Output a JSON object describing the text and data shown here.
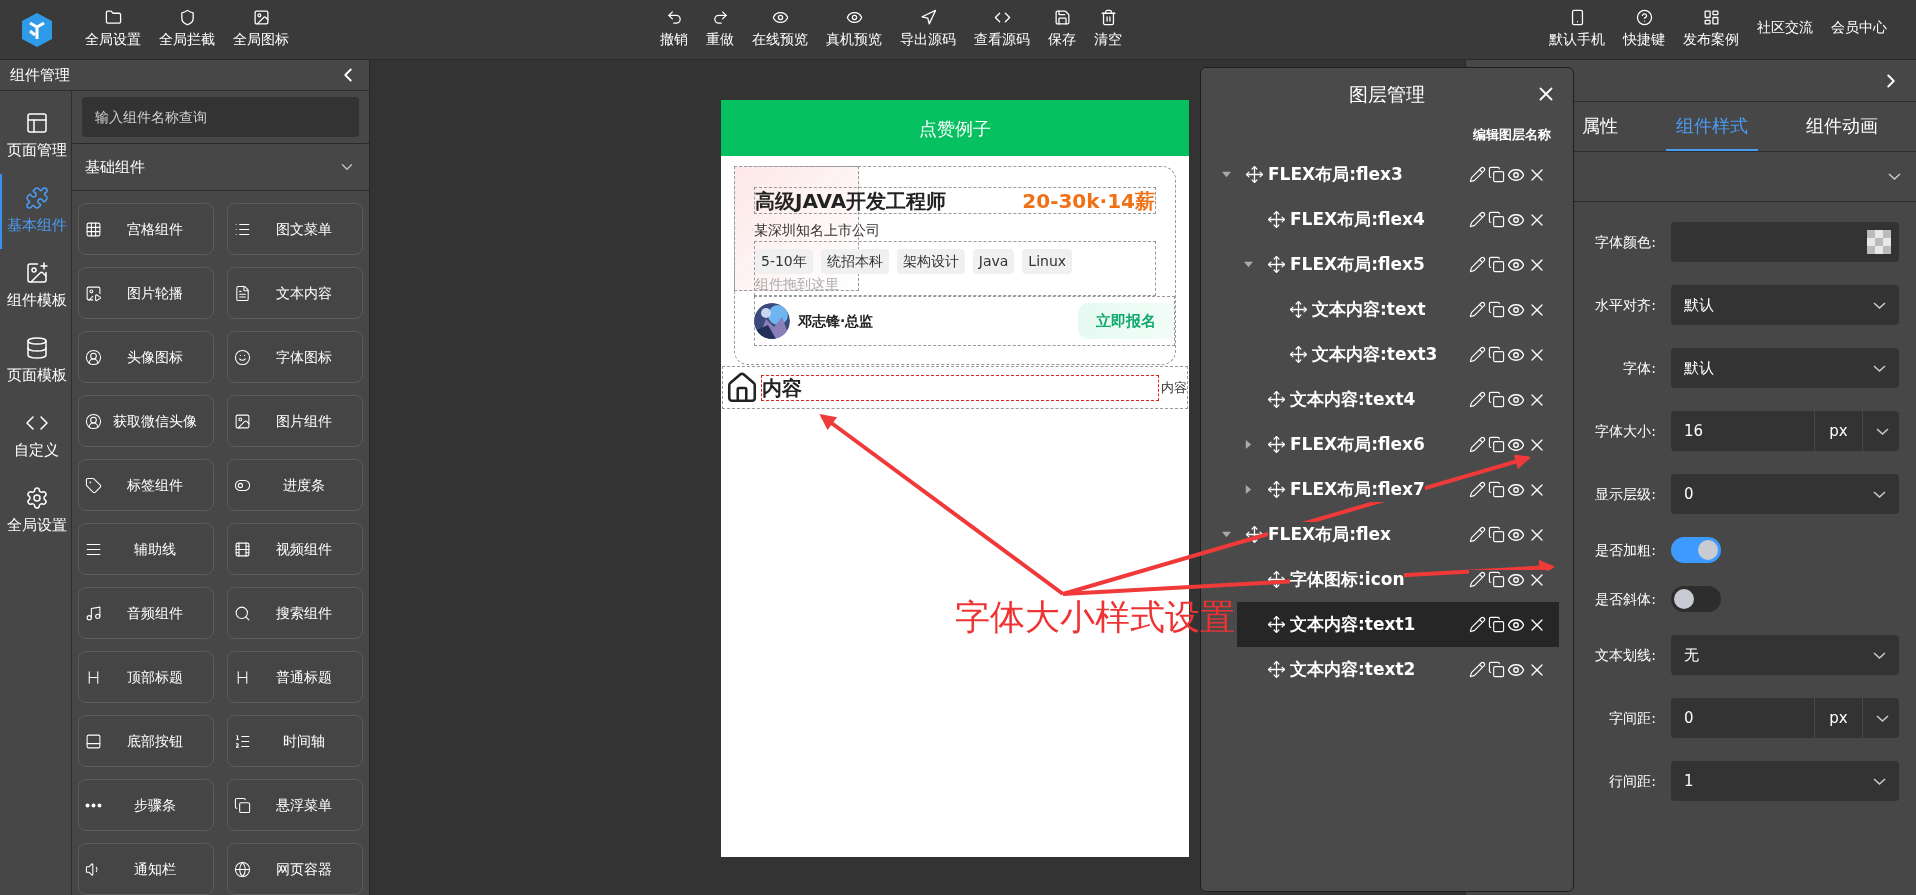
{
  "toolbar": {
    "left": [
      {
        "label": "全局设置"
      },
      {
        "label": "全局拦截"
      },
      {
        "label": "全局图标"
      }
    ],
    "center": [
      {
        "label": "撤销"
      },
      {
        "label": "重做"
      },
      {
        "label": "在线预览"
      },
      {
        "label": "真机预览"
      },
      {
        "label": "导出源码"
      },
      {
        "label": "查看源码"
      },
      {
        "label": "保存"
      },
      {
        "label": "清空"
      }
    ],
    "right": [
      {
        "label": "默认手机",
        "kind": "icon"
      },
      {
        "label": "快捷键",
        "kind": "icon"
      },
      {
        "label": "发布案例",
        "kind": "icon"
      },
      {
        "label": "社区交流",
        "kind": "text"
      },
      {
        "label": "会员中心",
        "kind": "text"
      }
    ]
  },
  "left_panel": {
    "title": "组件管理",
    "rail": [
      {
        "label": "页面管理",
        "selected": false
      },
      {
        "label": "基本组件",
        "selected": true
      },
      {
        "label": "组件模板",
        "selected": false
      },
      {
        "label": "页面模板",
        "selected": false
      },
      {
        "label": "自定义",
        "selected": false
      },
      {
        "label": "全局设置",
        "selected": false
      }
    ],
    "search": {
      "placeholder": "输入组件名称查询"
    },
    "category": {
      "label": "基础组件",
      "expanded": true
    },
    "components": [
      {
        "label": "宫格组件"
      },
      {
        "label": "图文菜单"
      },
      {
        "label": "图片轮播"
      },
      {
        "label": "文本内容"
      },
      {
        "label": "头像图标"
      },
      {
        "label": "字体图标"
      },
      {
        "label": "获取微信头像"
      },
      {
        "label": "图片组件"
      },
      {
        "label": "标签组件"
      },
      {
        "label": "进度条"
      },
      {
        "label": "辅助线"
      },
      {
        "label": "视频组件"
      },
      {
        "label": "音频组件"
      },
      {
        "label": "搜索组件"
      },
      {
        "label": "顶部标题"
      },
      {
        "label": "普通标题"
      },
      {
        "label": "底部按钮"
      },
      {
        "label": "时间轴"
      },
      {
        "label": "步骤条"
      },
      {
        "label": "悬浮菜单"
      },
      {
        "label": "通知栏"
      },
      {
        "label": "网页容器"
      }
    ]
  },
  "phone": {
    "title": "点赞例子",
    "card": {
      "job": "高级JAVA开发工程师",
      "salary": "20-30k·14薪",
      "company": "某深圳知名上市公司",
      "tags": [
        "5-10年",
        "统招本科",
        "架构设计",
        "Java",
        "Linux"
      ],
      "drop_hint": "组件拖到这里",
      "person": "邓志锋·总监",
      "button": "立即报名"
    },
    "row": {
      "text": "内容",
      "side_text": "内容"
    }
  },
  "layers": {
    "title": "图层管理",
    "edit_label": "编辑图层名称",
    "items": [
      {
        "label": "FLEX布局:flex3",
        "kind": "group",
        "expanded": true,
        "selected": false,
        "children": [
          {
            "label": "FLEX布局:flex4",
            "kind": "leaf",
            "selected": false
          },
          {
            "label": "FLEX布局:flex5",
            "kind": "group",
            "expanded": true,
            "selected": false,
            "children": [
              {
                "label": "文本内容:text",
                "kind": "leaf",
                "selected": false
              },
              {
                "label": "文本内容:text3",
                "kind": "leaf",
                "selected": false
              }
            ]
          },
          {
            "label": "文本内容:text4",
            "kind": "leaf",
            "selected": false
          },
          {
            "label": "FLEX布局:flex6",
            "kind": "group",
            "expanded": false,
            "selected": false
          },
          {
            "label": "FLEX布局:flex7",
            "kind": "group",
            "expanded": false,
            "selected": false
          }
        ]
      },
      {
        "label": "FLEX布局:flex",
        "kind": "group",
        "expanded": true,
        "selected": false,
        "children": [
          {
            "label": "字体图标:icon",
            "kind": "leaf",
            "selected": false
          },
          {
            "label": "文本内容:text1",
            "kind": "leaf",
            "selected": true
          },
          {
            "label": "文本内容:text2",
            "kind": "leaf",
            "selected": false
          }
        ]
      }
    ]
  },
  "properties": {
    "tabs": [
      {
        "label": "属性",
        "selected": false
      },
      {
        "label": "组件样式",
        "selected": true
      },
      {
        "label": "组件动画",
        "selected": false
      }
    ],
    "section": {
      "expanded": true
    },
    "fields": [
      {
        "label": "字体颜色:",
        "kind": "color"
      },
      {
        "label": "水平对齐:",
        "kind": "select",
        "value": "默认"
      },
      {
        "label": "字体:",
        "kind": "select",
        "value": "默认"
      },
      {
        "label": "字体大小:",
        "kind": "unit",
        "value": "16",
        "unit": "px"
      },
      {
        "label": "显示层级:",
        "kind": "select",
        "value": "0"
      },
      {
        "label": "是否加粗:",
        "kind": "switch",
        "on": true
      },
      {
        "label": "是否斜体:",
        "kind": "switch",
        "on": false
      },
      {
        "label": "文本划线:",
        "kind": "select",
        "value": "无"
      },
      {
        "label": "字间距:",
        "kind": "unit",
        "value": "0",
        "unit": "px"
      },
      {
        "label": "行间距:",
        "kind": "select",
        "value": "1"
      }
    ]
  },
  "annotation": {
    "text": "字体大小样式设置"
  }
}
